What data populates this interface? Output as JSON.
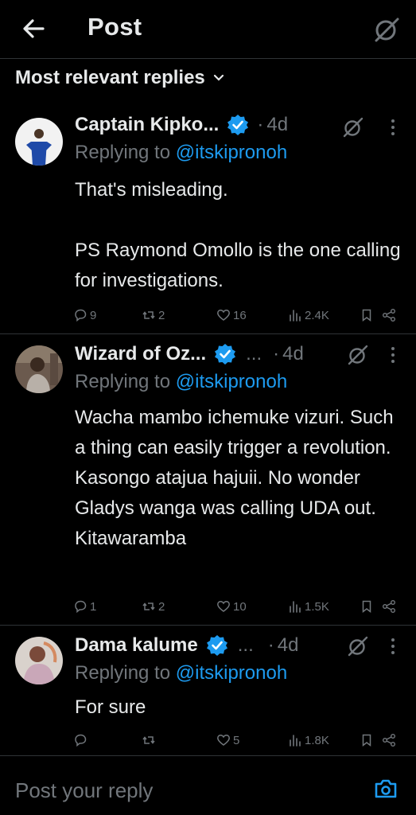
{
  "header": {
    "title": "Post"
  },
  "sort": {
    "label": "Most relevant replies"
  },
  "tweets": [
    {
      "name": "Captain Kipko...",
      "show_trunc_dots": false,
      "time": "4d",
      "replying_prefix": "Replying to ",
      "replying_handle": "@itskipronoh",
      "text": "That's misleading.\n\nPS Raymond Omollo is the one calling for investigations.",
      "stats": {
        "replies": "9",
        "reposts": "2",
        "likes": "16",
        "views": "2.4K"
      }
    },
    {
      "name": "Wizard of Oz...",
      "trunc_dots": "...",
      "time": "4d",
      "replying_prefix": "Replying to ",
      "replying_handle": "@itskipronoh",
      "text": "Wacha mambo ichemuke vizuri. Such a thing can easily trigger a revolution. Kasongo atajua hajuii. No wonder Gladys wanga was calling UDA out. Kitawaramba",
      "stats": {
        "replies": "1",
        "reposts": "2",
        "likes": "10",
        "views": "1.5K"
      }
    },
    {
      "name": "Dama kalume",
      "trunc_dots": "...",
      "time": "4d",
      "replying_prefix": "Replying to ",
      "replying_handle": "@itskipronoh",
      "text": "For sure",
      "stats": {
        "replies": "",
        "reposts": "",
        "likes": "5",
        "views": "1.8K"
      }
    }
  ],
  "composer": {
    "placeholder": "Post your reply"
  },
  "colors": {
    "accent": "#1d9bf0",
    "muted": "#71767b",
    "text": "#e7e9ea",
    "border": "#2f3336",
    "background": "#000000"
  }
}
